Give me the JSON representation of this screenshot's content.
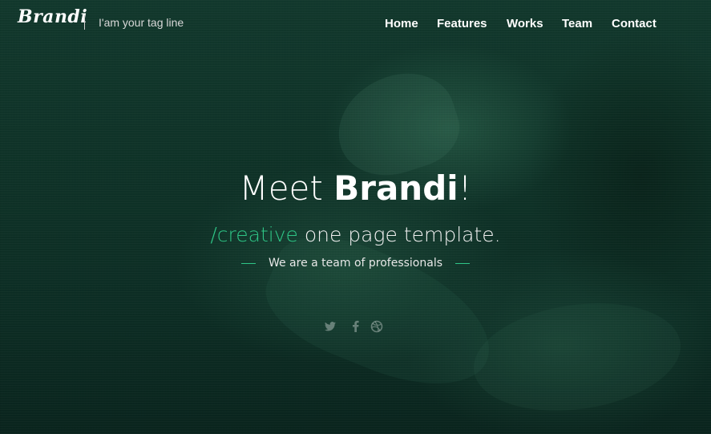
{
  "brand": {
    "logo_text": "Brandi",
    "tagline": "I'am your tag line"
  },
  "nav": {
    "items": [
      {
        "label": "Home"
      },
      {
        "label": "Features"
      },
      {
        "label": "Works"
      },
      {
        "label": "Team"
      },
      {
        "label": "Contact"
      }
    ]
  },
  "hero": {
    "title_prefix": "Meet ",
    "title_strong": "Brandi",
    "title_suffix": "!",
    "subtitle_accent": "/creative",
    "subtitle_rest": " one page template.",
    "small_text": "We are a team of professionals"
  },
  "social": {
    "icons": [
      "twitter-icon",
      "facebook-icon",
      "dribbble-icon"
    ]
  },
  "colors": {
    "accent": "#2ec586",
    "background": "#0f3328"
  }
}
